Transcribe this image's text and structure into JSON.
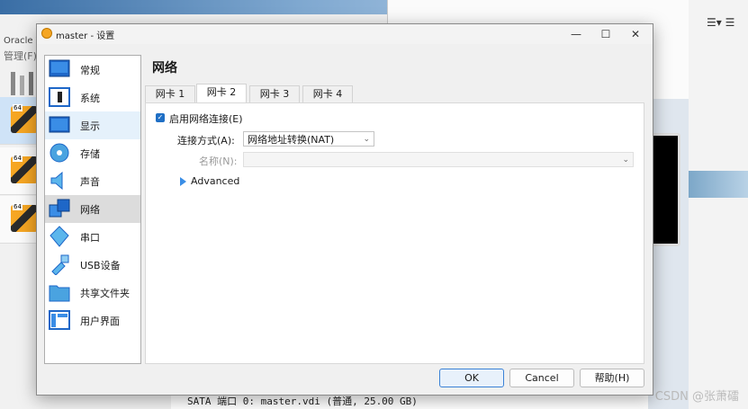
{
  "background": {
    "vbox_title": "Oracle VM VirtualBox 管理器",
    "vbox_menu": "管理(F)",
    "bottom_line": "SATA 端口 0:       master.vdi (普通, 25.00 GB)",
    "watermark": "CSDN @张萧礌",
    "vm_badge": "64"
  },
  "dialog": {
    "title": "master - 设置",
    "window_buttons": {
      "minimize": "—",
      "maximize": "☐",
      "close": "✕"
    }
  },
  "sidebar": {
    "items": [
      {
        "label": "常规",
        "icon": "general-icon"
      },
      {
        "label": "系统",
        "icon": "system-icon"
      },
      {
        "label": "显示",
        "icon": "display-icon"
      },
      {
        "label": "存储",
        "icon": "storage-icon"
      },
      {
        "label": "声音",
        "icon": "audio-icon"
      },
      {
        "label": "网络",
        "icon": "network-icon"
      },
      {
        "label": "串口",
        "icon": "serial-port-icon"
      },
      {
        "label": "USB设备",
        "icon": "usb-icon"
      },
      {
        "label": "共享文件夹",
        "icon": "shared-folder-icon"
      },
      {
        "label": "用户界面",
        "icon": "user-interface-icon"
      }
    ],
    "selected": "网络",
    "hovered": "显示"
  },
  "panel": {
    "title": "网络",
    "tabs": [
      "网卡 1",
      "网卡 2",
      "网卡 3",
      "网卡 4"
    ],
    "active_tab": "网卡 2",
    "enable_label": "启用网络连接(E)",
    "enable_checked": true,
    "attach_label": "连接方式(A):",
    "attach_value": "网络地址转换(NAT)",
    "name_label": "名称(N):",
    "name_value": "",
    "advanced_label": "Advanced"
  },
  "buttons": {
    "ok": "OK",
    "cancel": "Cancel",
    "help": "帮助(H)"
  },
  "colors": {
    "accent": "#1f6fc5",
    "selected_nav": "#dcdcdc",
    "hover_nav": "#e5f1fb"
  }
}
